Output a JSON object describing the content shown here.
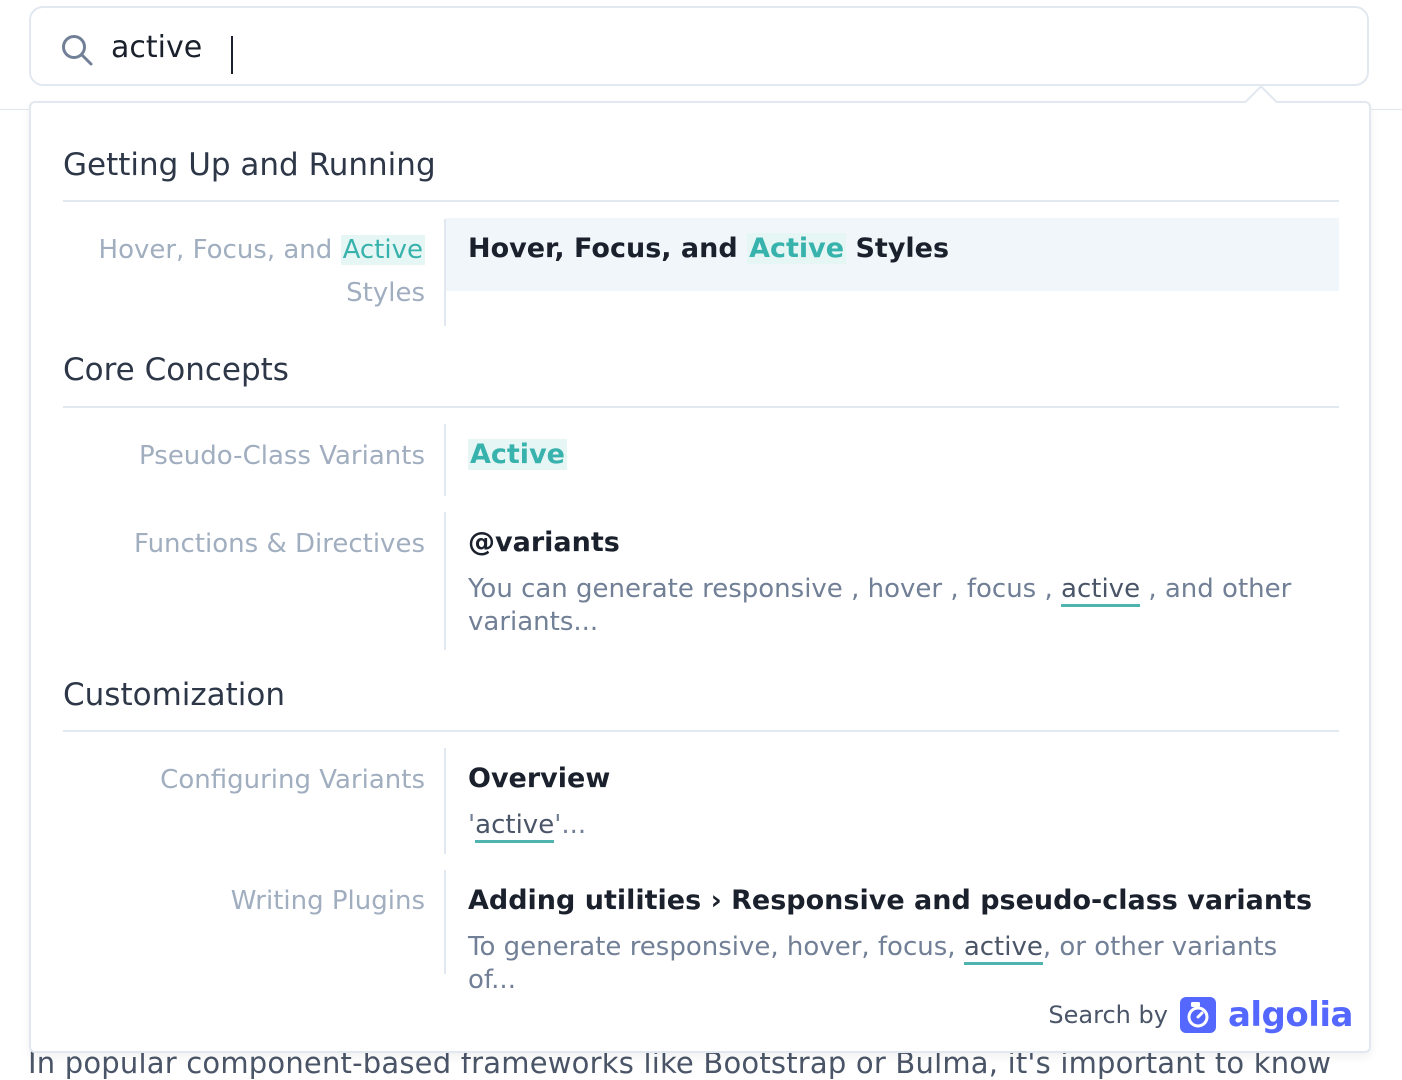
{
  "search": {
    "query": "active"
  },
  "sections": [
    {
      "title": "Getting Up and Running",
      "hits": [
        {
          "lvl1_pre": "Hover, Focus, and ",
          "lvl1_hl": "Active",
          "lvl1_post": " Styles",
          "title_pre": "Hover, Focus, and ",
          "title_hl": "Active",
          "title_post": " Styles"
        }
      ]
    },
    {
      "title": "Core Concepts",
      "hits": [
        {
          "lvl1": "Pseudo-Class Variants",
          "title_hl": "Active"
        },
        {
          "lvl1": "Functions & Directives",
          "title": "@variants",
          "snippet_pre": "You can generate responsive , hover , focus , ",
          "snippet_hl": "active",
          "snippet_post": " , and other variants..."
        }
      ]
    },
    {
      "title": "Customization",
      "hits": [
        {
          "lvl1": "Configuring Variants",
          "title": "Overview",
          "snippet_pre": "'",
          "snippet_hl": "active",
          "snippet_post": "'..."
        },
        {
          "lvl1": "Writing Plugins",
          "title": "Adding utilities › Responsive and pseudo-class variants",
          "snippet_pre": "To generate responsive, hover, focus, ",
          "snippet_hl": "active",
          "snippet_post": ", or other variants of..."
        }
      ]
    }
  ],
  "footer": {
    "search_by": "Search by",
    "brand": "algolia"
  },
  "background_text": "In popular component-based frameworks like Bootstrap or Bulma, it's important to know",
  "icons": {
    "search": "search-icon",
    "algolia": "algolia-logo-icon"
  },
  "colors": {
    "highlight": "#38b2ac",
    "highlight_bg": "#e6f6f4",
    "selected_bg": "#f1f6fb",
    "algolia": "#5468ff"
  }
}
